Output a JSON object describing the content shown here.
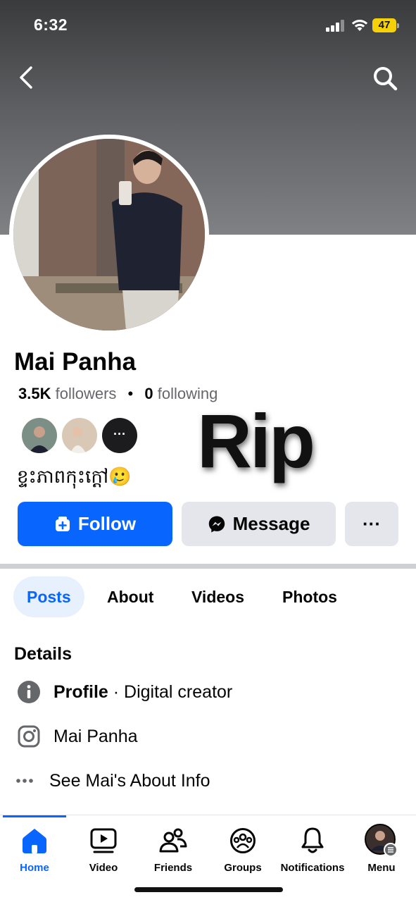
{
  "status_bar": {
    "time": "6:32",
    "battery": "47"
  },
  "profile": {
    "name": "Mai Panha",
    "followers_count": "3.5K",
    "followers_label": "followers",
    "separator": "•",
    "following_count": "0",
    "following_label": "following",
    "bio": "ខ្ទះភាពកុះក្តៅ🥲",
    "more_friends_label": "···"
  },
  "overlay_text": "Rip",
  "actions": {
    "follow_label": "Follow",
    "message_label": "Message",
    "more_label": "···"
  },
  "tabs": [
    {
      "label": "Posts",
      "active": true
    },
    {
      "label": "About"
    },
    {
      "label": "Videos"
    },
    {
      "label": "Photos"
    }
  ],
  "details": {
    "title": "Details",
    "rows": [
      {
        "icon": "info-icon",
        "bold": "Profile",
        "text": " · Digital creator"
      },
      {
        "icon": "instagram-icon",
        "text": "Mai Panha"
      },
      {
        "icon": "more-dots-icon",
        "text": "See Mai's About Info"
      }
    ]
  },
  "bottom_nav": [
    {
      "label": "Home",
      "icon": "home-icon",
      "active": true
    },
    {
      "label": "Video",
      "icon": "video-icon"
    },
    {
      "label": "Friends",
      "icon": "friends-icon"
    },
    {
      "label": "Groups",
      "icon": "groups-icon"
    },
    {
      "label": "Notifications",
      "icon": "bell-icon"
    },
    {
      "label": "Menu",
      "icon": "menu-avatar-icon"
    }
  ],
  "colors": {
    "accent": "#0866ff",
    "secondary_button": "#e4e6eb",
    "tab_active_bg": "#e7f0fd",
    "battery": "#f5d10a"
  }
}
